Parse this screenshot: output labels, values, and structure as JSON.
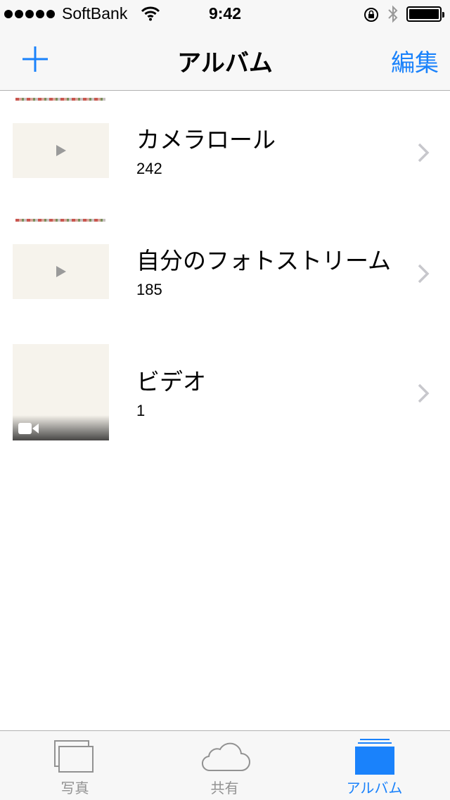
{
  "status_bar": {
    "carrier": "SoftBank",
    "time": "9:42",
    "battery_level": 1.0
  },
  "nav": {
    "title": "アルバム",
    "add_icon": "plus-icon",
    "edit_label": "編集"
  },
  "albums": [
    {
      "title": "カメラロール",
      "count": "242",
      "thumb_icon": "play-icon"
    },
    {
      "title": "自分のフォトストリーム",
      "count": "185",
      "thumb_icon": "play-icon"
    },
    {
      "title": "ビデオ",
      "count": "1",
      "thumb_icon": "video-camera-icon"
    }
  ],
  "tabs": [
    {
      "label": "写真",
      "icon": "photos-icon",
      "active": false
    },
    {
      "label": "共有",
      "icon": "cloud-icon",
      "active": false
    },
    {
      "label": "アルバム",
      "icon": "albums-icon",
      "active": true
    }
  ],
  "colors": {
    "accent": "#1a82fb",
    "inactive": "#929292",
    "bar_background": "#f7f7f7"
  }
}
